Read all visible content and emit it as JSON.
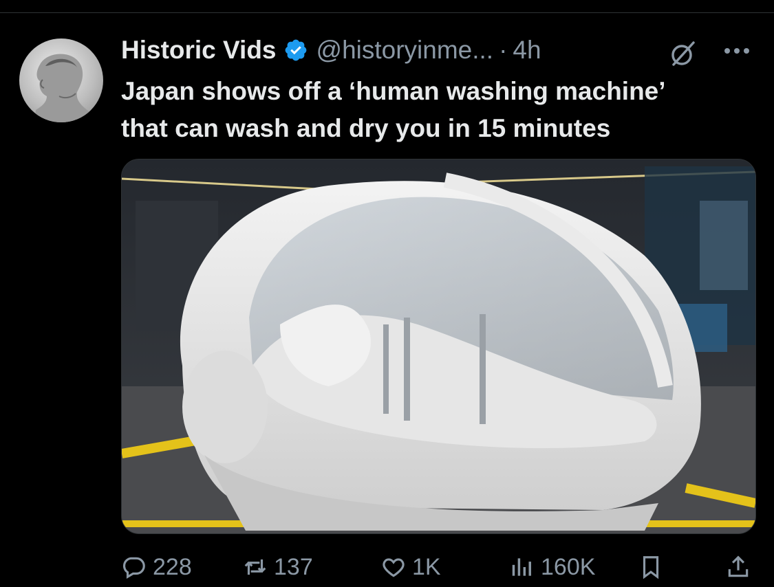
{
  "post": {
    "author_name": "Historic Vids",
    "handle": "@historyinme...",
    "separator": "·",
    "time": "4h",
    "text_line1": "Japan shows off a ‘human washing machine’",
    "text_line2": "that can wash and dry you in 15 minutes"
  },
  "metrics": {
    "replies": "228",
    "reposts": "137",
    "likes": "1K",
    "views": "160K"
  },
  "icons": {
    "verified": "verified-badge-icon",
    "grok": "grok-icon",
    "more": "more-dots-icon",
    "reply": "reply-icon",
    "repost": "repost-icon",
    "like": "heart-icon",
    "views": "views-chart-icon",
    "bookmark": "bookmark-icon",
    "share": "share-icon"
  },
  "colors": {
    "background": "#000000",
    "text": "#e7e9ea",
    "secondary": "#8b98a5",
    "verified": "#1d9bf0"
  }
}
